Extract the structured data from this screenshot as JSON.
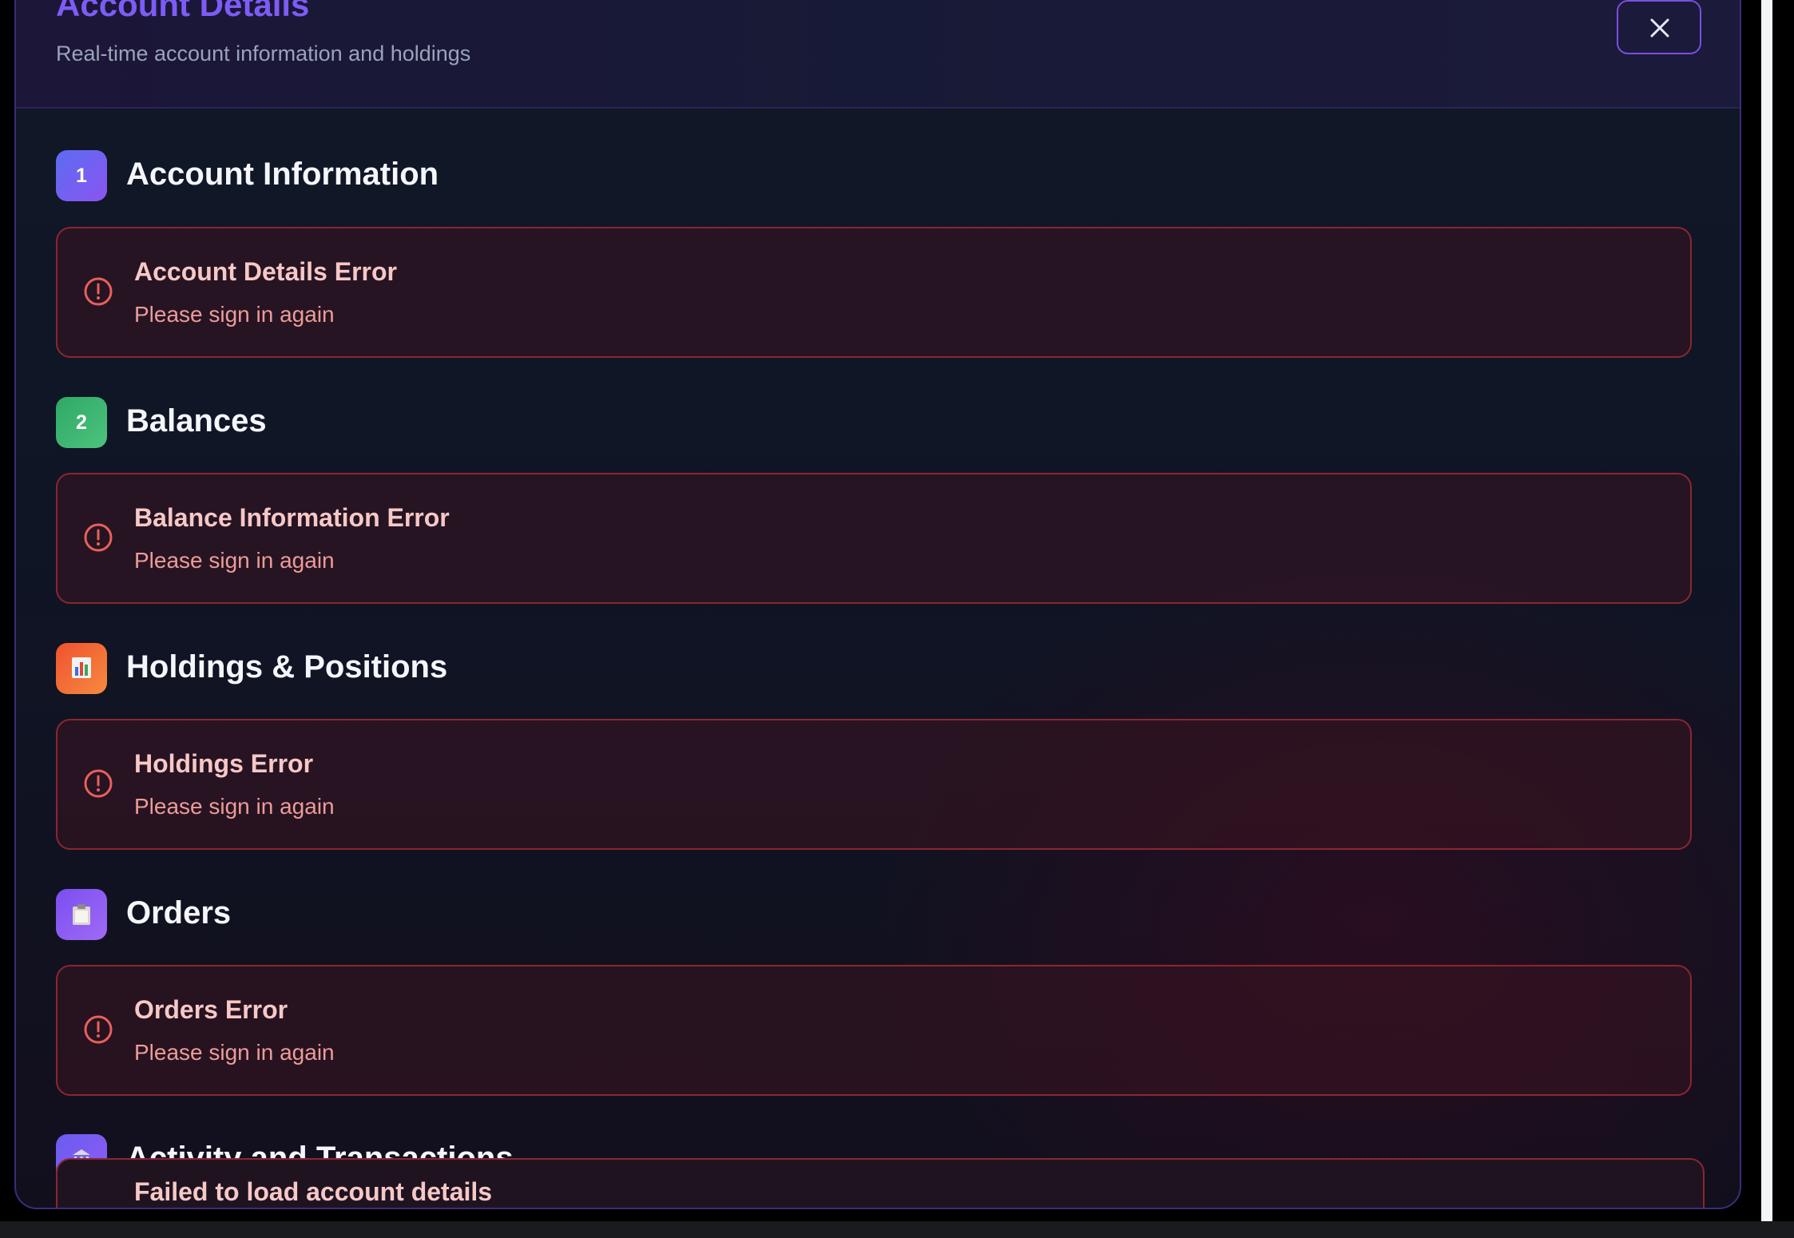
{
  "modal": {
    "title": "Account Details",
    "subtitle": "Real-time account information and holdings",
    "close_icon": "close-icon"
  },
  "sections": [
    {
      "badge": "1",
      "badge_color": "#6a5cf0",
      "title": "Account Information",
      "error_title": "Account Details Error",
      "error_message": "Please sign in again"
    },
    {
      "badge": "2",
      "badge_color": "#3fb36f",
      "title": "Balances",
      "error_title": "Balance Information Error",
      "error_message": "Please sign in again"
    },
    {
      "badge_icon": "bar-chart-icon",
      "badge_color": "#f06a36",
      "title": "Holdings & Positions",
      "error_title": "Holdings Error",
      "error_message": "Please sign in again"
    },
    {
      "badge_icon": "clipboard-icon",
      "badge_color": "#8b5cf6",
      "title": "Orders",
      "error_title": "Orders Error",
      "error_message": "Please sign in again"
    },
    {
      "badge_icon": "bank-icon",
      "badge_color": "#7c5cf2",
      "title": "Activity and Transactions"
    }
  ],
  "bottom_error": {
    "message": "Failed to load account details"
  },
  "colors": {
    "title_accent": "#7d5cf6",
    "error_border": "#8c2630",
    "error_icon": "#e8605a"
  }
}
